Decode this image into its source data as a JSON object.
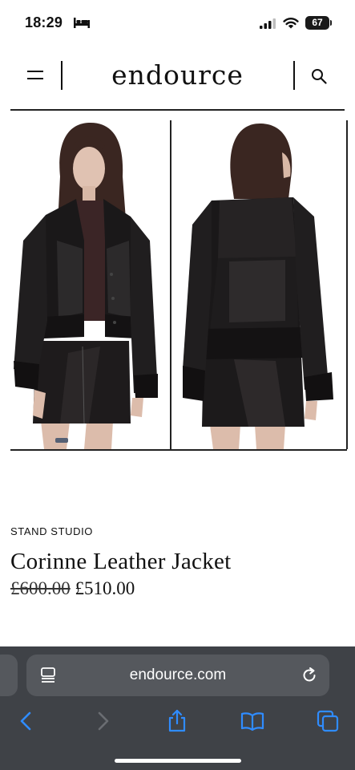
{
  "status_bar": {
    "time": "18:29",
    "focus_icon": "bed-icon",
    "battery_level": "67"
  },
  "header": {
    "brand_logo": "endource",
    "menu_icon": "hamburger-menu-icon",
    "search_icon": "search-icon"
  },
  "gallery": {
    "images": [
      {
        "name": "product-image-front",
        "description_icon": "jacket-front-photo"
      },
      {
        "name": "product-image-back",
        "description_icon": "jacket-back-photo"
      }
    ]
  },
  "product": {
    "brand": "STAND STUDIO",
    "title": "Corinne Leather Jacket",
    "price_original": "£600.00",
    "price_sale": "£510.00"
  },
  "browser": {
    "url": "endource.com",
    "toolbar_icons": [
      "back-icon",
      "forward-icon",
      "share-icon",
      "bookmarks-icon",
      "tabs-icon"
    ],
    "accent_color": "#2f8cff",
    "bar_color": "#3f4247"
  }
}
